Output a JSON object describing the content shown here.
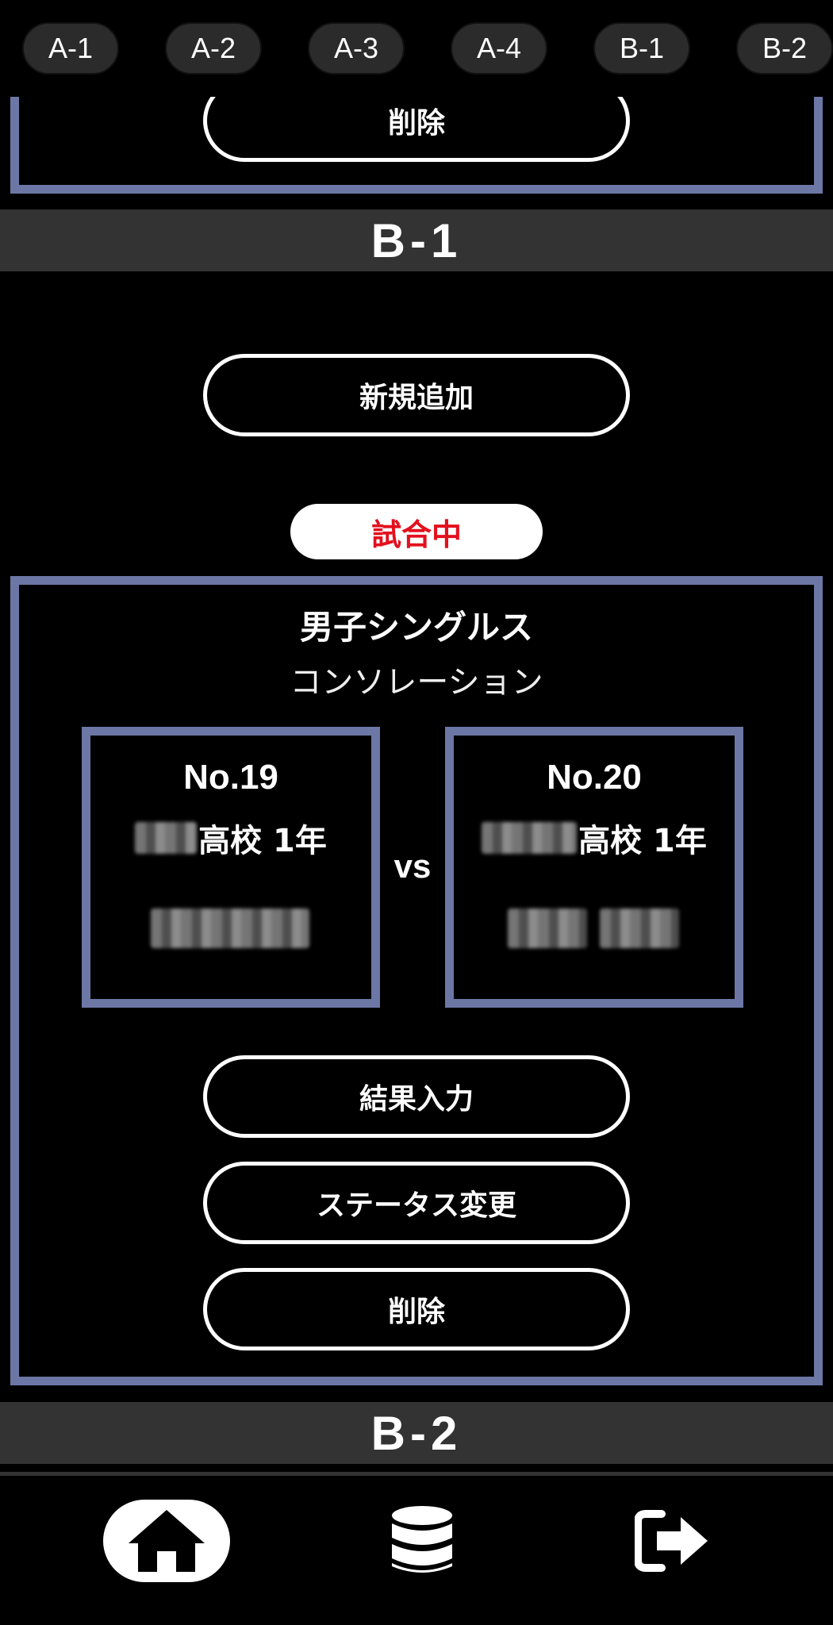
{
  "court_tabs": [
    "A-1",
    "A-2",
    "A-3",
    "A-4",
    "B-1",
    "B-2"
  ],
  "prev_section": {
    "delete_label": "削除"
  },
  "sections": [
    {
      "title": "B-1"
    },
    {
      "title": "B-2"
    }
  ],
  "b1": {
    "add_label": "新規追加",
    "status": "試合中",
    "status_color": "#e3101d",
    "match": {
      "event": "男子シングルス",
      "round": "コンソレーション",
      "vs": "vs",
      "player1": {
        "no": "No.19",
        "school_suffix": "高校 1年"
      },
      "player2": {
        "no": "No.20",
        "school_suffix": "高校 1年"
      },
      "actions": {
        "result": "結果入力",
        "status_change": "ステータス変更",
        "delete": "削除"
      }
    }
  },
  "nav": {
    "home_icon": "home-icon",
    "database_icon": "database-icon",
    "logout_icon": "logout-icon"
  },
  "colors": {
    "box_border": "#6d77a5",
    "section_bar": "#333333"
  }
}
